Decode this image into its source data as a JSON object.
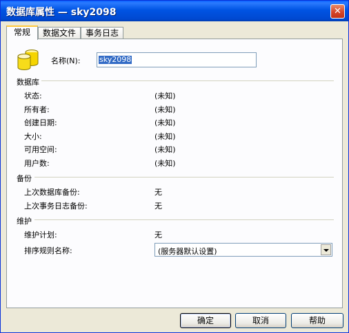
{
  "window": {
    "title": "数据库属性 — sky2098"
  },
  "tabs": [
    {
      "label": "常规"
    },
    {
      "label": "数据文件"
    },
    {
      "label": "事务日志"
    }
  ],
  "name_field": {
    "label": "名称(N):",
    "value": "sky2098"
  },
  "database": {
    "header": "数据库",
    "rows": [
      {
        "label": "状态:",
        "value": "(未知)"
      },
      {
        "label": "所有者:",
        "value": "(未知)"
      },
      {
        "label": "创建日期:",
        "value": "(未知)"
      },
      {
        "label": "大小:",
        "value": "(未知)"
      },
      {
        "label": "可用空间:",
        "value": "(未知)"
      },
      {
        "label": "用户数:",
        "value": "(未知)"
      }
    ]
  },
  "backup": {
    "header": "备份",
    "rows": [
      {
        "label": "上次数据库备份:",
        "value": "无"
      },
      {
        "label": "上次事务日志备份:",
        "value": "无"
      }
    ]
  },
  "maintenance": {
    "header": "维护",
    "plan_label": "维护计划:",
    "plan_value": "无",
    "collation_label": "排序规则名称:",
    "collation_value": "(服务器默认设置)"
  },
  "buttons": {
    "ok": "确定",
    "cancel": "取消",
    "help": "帮助"
  }
}
